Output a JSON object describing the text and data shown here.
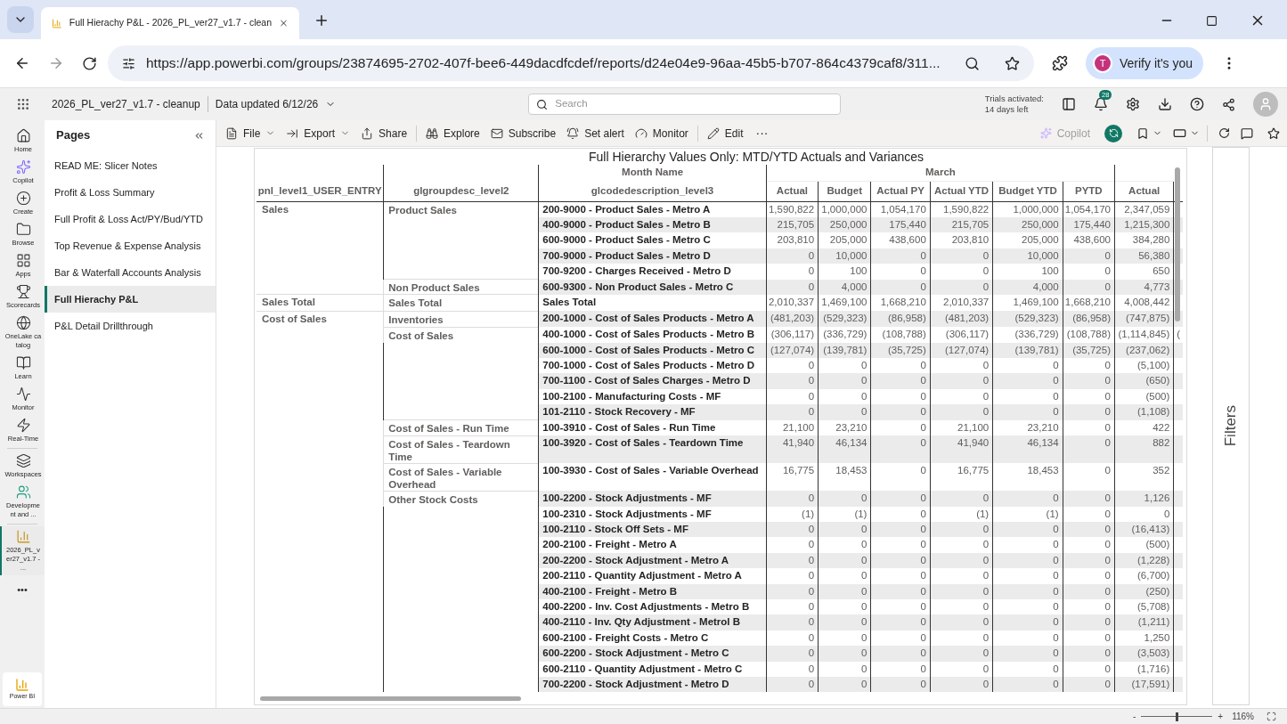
{
  "browser": {
    "tab_title": "Full Hierachy P&L - 2026_PL_ver27_v1.7 - clean",
    "url": "https://app.powerbi.com/groups/23874695-2702-407f-bee6-449dacdfcdef/reports/d24e04e9-96aa-45b5-b707-864c4379caf8/311...",
    "profile_initial": "T",
    "profile_label": "Verify it's you"
  },
  "header": {
    "report_name": "2026_PL_ver27_v1.7 - cleanup",
    "data_updated": "Data updated 6/12/26",
    "search_placeholder": "Search",
    "trial_line1": "Trials activated:",
    "trial_line2": "14 days left",
    "notification_count": "28"
  },
  "nav_rail": [
    {
      "kind": "home",
      "label": "Home",
      "selected": false
    },
    {
      "kind": "copilot",
      "label": "Copilot",
      "selected": false
    },
    {
      "kind": "create",
      "label": "Create",
      "selected": false
    },
    {
      "kind": "browse",
      "label": "Browse",
      "selected": false
    },
    {
      "kind": "apps",
      "label": "Apps",
      "selected": false
    },
    {
      "kind": "scorecards",
      "label": "Scorecards",
      "selected": false
    },
    {
      "kind": "onelake",
      "label": "OneLake catalog",
      "selected": false
    },
    {
      "kind": "learn",
      "label": "Learn",
      "selected": false
    },
    {
      "kind": "monitor",
      "label": "Monitor",
      "selected": false
    },
    {
      "kind": "realtime",
      "label": "Real-Time",
      "selected": false
    },
    {
      "kind": "workspaces",
      "label": "Workspaces",
      "selected": false
    },
    {
      "kind": "workspace",
      "label": "Development and ...",
      "selected": false
    },
    {
      "kind": "report",
      "label": "2026_PL_ver27_v1.7 - ...",
      "selected": true
    }
  ],
  "more": "•••",
  "product": "Power BI",
  "pages": {
    "title": "Pages",
    "items": [
      {
        "label": "READ ME: Slicer Notes",
        "selected": false
      },
      {
        "label": "Profit & Loss Summary",
        "selected": false
      },
      {
        "label": "Full Profit & Loss Act/PY/Bud/YTD",
        "selected": false
      },
      {
        "label": "Top Revenue & Expense Analysis",
        "selected": false
      },
      {
        "label": "Bar & Waterfall Accounts Analysis",
        "selected": false
      },
      {
        "label": "Full Hierachy P&L",
        "selected": true
      },
      {
        "label": "P&L Detail Drillthrough",
        "selected": false
      }
    ]
  },
  "toolbar": {
    "file": "File",
    "export": "Export",
    "share": "Share",
    "explore": "Explore",
    "subscribe": "Subscribe",
    "set_alert": "Set alert",
    "monitor": "Monitor",
    "edit": "Edit",
    "more": "···",
    "copilot": "Copilot"
  },
  "visual": {
    "title": "Full Hierarchy Values Only: MTD/YTD Actuals and Variances",
    "month_label": "Month Name",
    "month": "March",
    "row_headers": [
      "pnl_level1_USER_ENTRY",
      "glgroupdesc_level2",
      "glcodedescription_level3"
    ],
    "columns": [
      "Actual",
      "Budget",
      "Actual PY",
      "Actual YTD",
      "Budget YTD",
      "PYTD",
      "Actual"
    ],
    "rows": [
      {
        "level1": "Sales",
        "level2": "Product Sales",
        "level3": "200-9000 - Product Sales - Metro A",
        "values": [
          "1,590,822",
          "1,000,000",
          "1,054,170",
          "1,590,822",
          "1,000,000",
          "1,054,170",
          "2,347,059"
        ]
      },
      {
        "level3": "400-9000 - Product Sales - Metro B",
        "values": [
          "215,705",
          "250,000",
          "175,440",
          "215,705",
          "250,000",
          "175,440",
          "1,215,300"
        ]
      },
      {
        "level3": "600-9000 - Product Sales - Metro C",
        "values": [
          "203,810",
          "205,000",
          "438,600",
          "203,810",
          "205,000",
          "438,600",
          "384,280"
        ]
      },
      {
        "level3": "700-9000 - Product Sales - Metro D",
        "values": [
          "0",
          "10,000",
          "0",
          "0",
          "10,000",
          "0",
          "56,380"
        ]
      },
      {
        "level3": "700-9200 - Charges Received - Metro D",
        "values": [
          "0",
          "100",
          "0",
          "0",
          "100",
          "0",
          "650"
        ]
      },
      {
        "level2": "Non Product Sales",
        "level3": "600-9300 - Non Product Sales - Metro C",
        "values": [
          "0",
          "4,000",
          "0",
          "0",
          "4,000",
          "0",
          "4,773"
        ]
      },
      {
        "level1": "Sales Total",
        "level2": "Sales Total",
        "level3": "Sales Total",
        "values": [
          "2,010,337",
          "1,469,100",
          "1,668,210",
          "2,010,337",
          "1,469,100",
          "1,668,210",
          "4,008,442"
        ]
      },
      {
        "level1": "Cost of Sales",
        "level2": "Inventories",
        "level3": "200-1000 - Cost of Sales Products - Metro A",
        "values": [
          "(481,203)",
          "(529,323)",
          "(86,958)",
          "(481,203)",
          "(529,323)",
          "(86,958)",
          "(747,875)"
        ]
      },
      {
        "level2": "Cost of Sales",
        "level3": "400-1000 - Cost of Sales Products - Metro B",
        "values": [
          "(306,117)",
          "(336,729)",
          "(108,788)",
          "(306,117)",
          "(336,729)",
          "(108,788)",
          "(1,114,845)"
        ],
        "column_8": "("
      },
      {
        "level3": "600-1000 - Cost of Sales Products - Metro C",
        "values": [
          "(127,074)",
          "(139,781)",
          "(35,725)",
          "(127,074)",
          "(139,781)",
          "(35,725)",
          "(237,062)"
        ]
      },
      {
        "level3": "700-1000 - Cost of Sales Products - Metro D",
        "values": [
          "0",
          "0",
          "0",
          "0",
          "0",
          "0",
          "(5,100)"
        ]
      },
      {
        "level3": "700-1100 - Cost of Sales Charges - Metro D",
        "values": [
          "0",
          "0",
          "0",
          "0",
          "0",
          "0",
          "(650)"
        ]
      },
      {
        "level3": "100-2100 - Manufacturing Costs - MF",
        "values": [
          "0",
          "0",
          "0",
          "0",
          "0",
          "0",
          "(500)"
        ]
      },
      {
        "level3": "101-2110 - Stock Recovery - MF",
        "values": [
          "0",
          "0",
          "0",
          "0",
          "0",
          "0",
          "(1,108)"
        ]
      },
      {
        "level2": "Cost of Sales - Run Time",
        "level3": "100-3910 - Cost of Sales - Run Time",
        "values": [
          "21,100",
          "23,210",
          "0",
          "21,100",
          "23,210",
          "0",
          "422"
        ]
      },
      {
        "level2": "Cost of Sales - Teardown Time",
        "level3": "100-3920 - Cost of Sales - Teardown Time",
        "values": [
          "41,940",
          "46,134",
          "0",
          "41,940",
          "46,134",
          "0",
          "882"
        ]
      },
      {
        "level2": "Cost of Sales - Variable Overhead",
        "level3": "100-3930 - Cost of Sales - Variable Overhead",
        "values": [
          "16,775",
          "18,453",
          "0",
          "16,775",
          "18,453",
          "0",
          "352"
        ]
      },
      {
        "level2": "Other Stock Costs",
        "level3": "100-2200 - Stock Adjustments - MF",
        "values": [
          "0",
          "0",
          "0",
          "0",
          "0",
          "0",
          "1,126"
        ]
      },
      {
        "level3": "100-2310 - Stock Adjustments - MF",
        "values": [
          "(1)",
          "(1)",
          "0",
          "(1)",
          "(1)",
          "0",
          "0"
        ]
      },
      {
        "level3": "100-2110 - Stock Off Sets - MF",
        "values": [
          "0",
          "0",
          "0",
          "0",
          "0",
          "0",
          "(16,413)"
        ]
      },
      {
        "level3": "200-2100 - Freight - Metro A",
        "values": [
          "0",
          "0",
          "0",
          "0",
          "0",
          "0",
          "(500)"
        ]
      },
      {
        "level3": "200-2200 - Stock Adjustment - Metro A",
        "values": [
          "0",
          "0",
          "0",
          "0",
          "0",
          "0",
          "(1,228)"
        ]
      },
      {
        "level3": "200-2110 - Quantity Adjustment - Metro A",
        "values": [
          "0",
          "0",
          "0",
          "0",
          "0",
          "0",
          "(6,700)"
        ]
      },
      {
        "level3": "400-2100 - Freight - Metro B",
        "values": [
          "0",
          "0",
          "0",
          "0",
          "0",
          "0",
          "(250)"
        ]
      },
      {
        "level3": "400-2200 - Inv. Cost Adjustments - Metro B",
        "values": [
          "0",
          "0",
          "0",
          "0",
          "0",
          "0",
          "(5,708)"
        ]
      },
      {
        "level3": "400-2110 - Inv. Qty Adjustment - Metrol B",
        "values": [
          "0",
          "0",
          "0",
          "0",
          "0",
          "0",
          "(1,211)"
        ]
      },
      {
        "level3": "600-2100 - Freight Costs - Metro C",
        "values": [
          "0",
          "0",
          "0",
          "0",
          "0",
          "0",
          "1,250"
        ]
      },
      {
        "level3": "600-2200 - Stock Adjustment - Metro C",
        "values": [
          "0",
          "0",
          "0",
          "0",
          "0",
          "0",
          "(3,503)"
        ]
      },
      {
        "level3": "600-2110 - Quantity Adjustment - Metro C",
        "values": [
          "0",
          "0",
          "0",
          "0",
          "0",
          "0",
          "(1,716)"
        ]
      },
      {
        "level3": "700-2200 - Stock Adjustment - Metro D",
        "values": [
          "0",
          "0",
          "0",
          "0",
          "0",
          "0",
          "(17,591)"
        ]
      }
    ]
  },
  "filters": {
    "label": "Filters"
  },
  "status_bar": {
    "zoom": {
      "level": 0.5
    },
    "minus": "-",
    "plus": "+",
    "zoom_reading": "116%"
  }
}
